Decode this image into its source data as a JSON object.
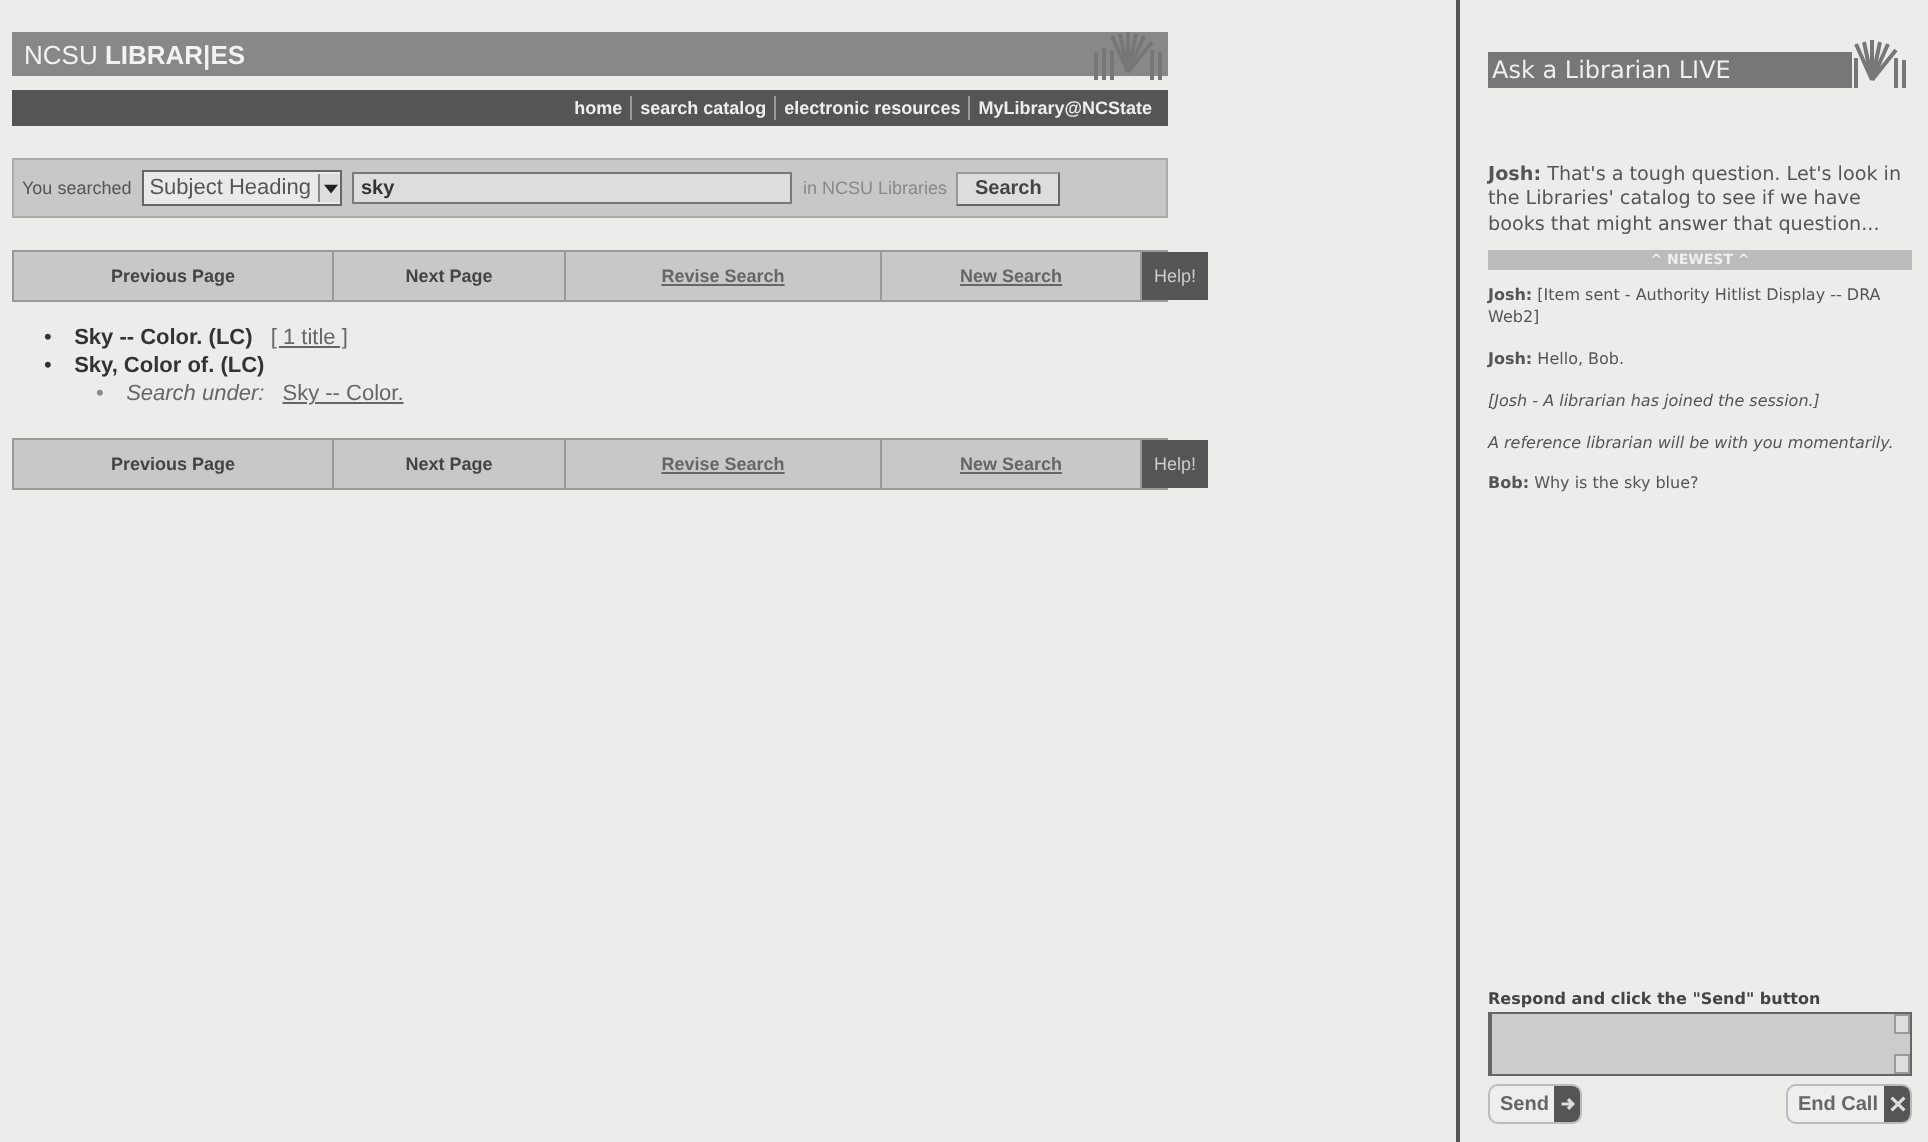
{
  "header": {
    "logo_left": "NCSU",
    "logo_right": "LIBRAR|ES"
  },
  "top_nav": [
    "home",
    "search catalog",
    "electronic resources",
    "MyLibrary@NCState"
  ],
  "search_bar": {
    "label": "You searched",
    "field_type": "Subject Heading",
    "query": "sky",
    "scope": "in NCSU Libraries",
    "button": "Search"
  },
  "nav_bar_top": [
    {
      "label": "Previous Page",
      "kind": "button"
    },
    {
      "label": "Next Page",
      "kind": "button"
    },
    {
      "label": "Revise Search",
      "kind": "link"
    },
    {
      "label": "New Search",
      "kind": "link"
    },
    {
      "label": "Help!",
      "kind": "help"
    }
  ],
  "results": [
    {
      "marker": "•",
      "heading": "Sky -- Color. (LC)",
      "link": "[ 1 title ]"
    },
    {
      "marker": "•",
      "heading": "Sky, Color of. (LC)",
      "children": [
        {
          "marker": "•",
          "label": "Search under:",
          "link": "Sky -- Color."
        }
      ]
    }
  ],
  "nav_bar_bottom": [
    {
      "label": "Previous Page",
      "kind": "button"
    },
    {
      "label": "Next Page",
      "kind": "button"
    },
    {
      "label": "Revise Search",
      "kind": "link"
    },
    {
      "label": "New Search",
      "kind": "link"
    },
    {
      "label": "Help!",
      "kind": "help"
    }
  ],
  "chat": {
    "title": "Ask a Librarian LIVE",
    "top_message": {
      "speaker": "Josh:",
      "text": "That's a tough question. Let's look in the Libraries' catalog to see if we have books that might answer that question..."
    },
    "divider": "^ NEWEST ^",
    "messages": [
      {
        "kind": "message",
        "speaker": "Josh:",
        "text": "[Item sent - Authority Hitlist Display -- DRA Web2]"
      },
      {
        "kind": "message",
        "speaker": "Josh:",
        "text": "Hello, Bob."
      },
      {
        "kind": "notice",
        "text": "[Josh - A librarian has joined the session.]"
      },
      {
        "kind": "notice",
        "text": "A reference librarian will be with you momentarily."
      },
      {
        "kind": "message",
        "speaker": "Bob:",
        "text": "Why is the sky blue?"
      }
    ],
    "prompt": "Respond and click the \"Send\" button",
    "send_button": "Send",
    "end_button": "End Call"
  }
}
